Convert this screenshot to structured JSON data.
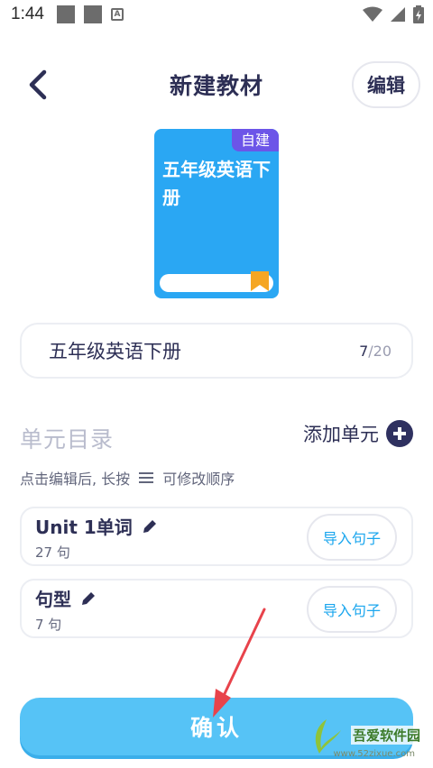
{
  "status_bar": {
    "time": "1:44",
    "a_icon": "A"
  },
  "header": {
    "title": "新建教材",
    "edit_label": "编辑",
    "back_icon": "chevron-left-icon"
  },
  "book": {
    "badge": "自建",
    "title": "五年级英语下册"
  },
  "name_field": {
    "value": "五年级英语下册",
    "count_current": "7",
    "count_max": "/20"
  },
  "units_section": {
    "title": "单元目录",
    "add_label": "添加单元",
    "hint_prefix": "点击编辑后, 长按",
    "hint_suffix": "可修改顺序",
    "items": [
      {
        "name": "Unit 1单词",
        "count": "27 句",
        "import_label": "导入句子"
      },
      {
        "name": "句型",
        "count": "7 句",
        "import_label": "导入句子"
      }
    ]
  },
  "confirm_label": "确认",
  "watermark": {
    "text": "吾爱软件园",
    "url": "www.52zixue.com"
  },
  "colors": {
    "primary_dark": "#2d2f55",
    "accent_blue": "#2aa7f3",
    "confirm_bg": "#56c3f6",
    "badge_purple": "#6c55e8",
    "annotation_red": "#e8434b"
  }
}
